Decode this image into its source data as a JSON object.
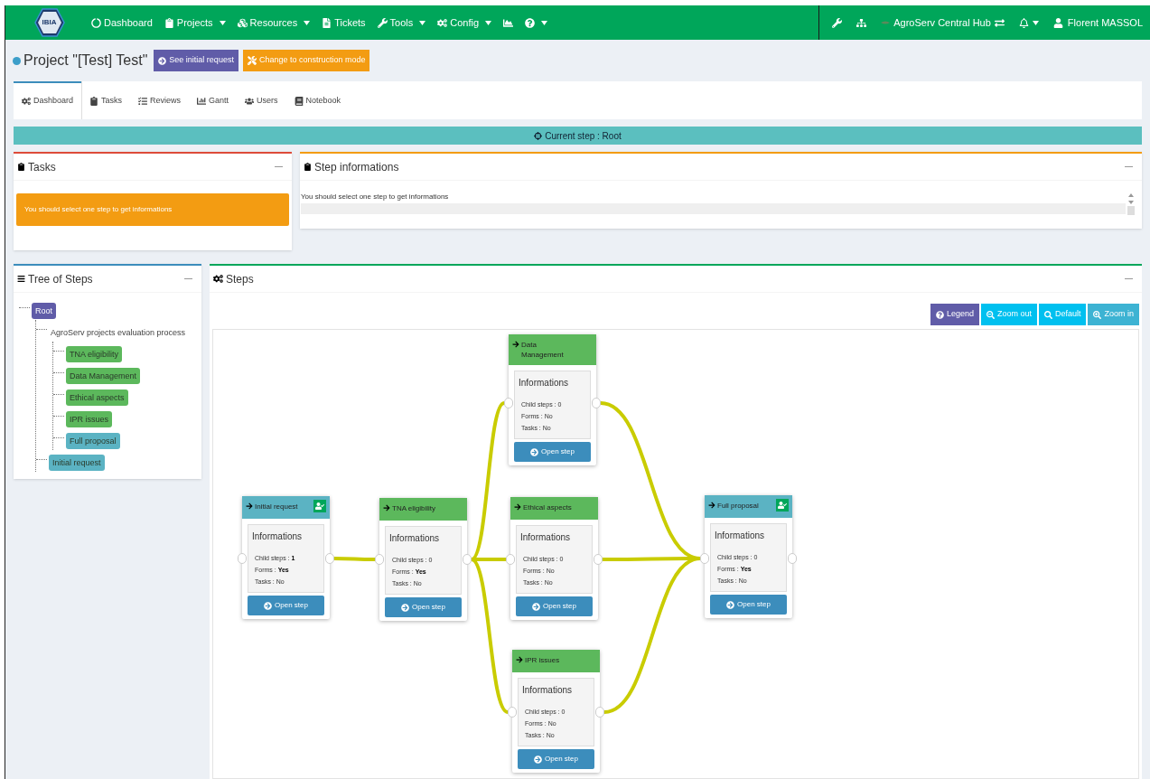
{
  "navbar": {
    "logo": "IBIA",
    "items": [
      {
        "label": "Dashboard",
        "dropdown": false
      },
      {
        "label": "Projects",
        "dropdown": true
      },
      {
        "label": "Resources",
        "dropdown": true
      },
      {
        "label": "Tickets",
        "dropdown": false
      },
      {
        "label": "Tools",
        "dropdown": true
      },
      {
        "label": "Config",
        "dropdown": true
      },
      {
        "dropdown": false
      },
      {
        "dropdown": true
      }
    ],
    "hub": "AgroServ Central Hub",
    "notifications_dropdown": true,
    "user": "Florent MASSOL"
  },
  "project": {
    "title": "Project \"[Test] Test\"",
    "buttons": [
      {
        "label": "See initial request",
        "color": "#605ca8"
      },
      {
        "label": "Change to construction mode",
        "color": "#f39c12"
      }
    ]
  },
  "tabs": [
    {
      "label": "Dashboard",
      "selected": true
    },
    {
      "label": "Tasks",
      "selected": false
    },
    {
      "label": "Reviews",
      "selected": false
    },
    {
      "label": "Gantt",
      "selected": false
    },
    {
      "label": "Users",
      "selected": false
    },
    {
      "label": "Notebook",
      "selected": false
    }
  ],
  "current_step": "Current step : Root",
  "tasks_box": {
    "title": "Tasks",
    "alert": "You should select one step to get informations"
  },
  "step_info": {
    "title": "Step informations",
    "message": "You should select one step to get informations"
  },
  "tree": {
    "title": "Tree of Steps",
    "items": [
      {
        "label": "Root",
        "color": "#605ca8",
        "children": [
          {
            "label": "AgroServ projects evaluation process",
            "children": [
              {
                "label": "TNA eligibility",
                "color": "#5cb85c"
              },
              {
                "label": "Data Management",
                "color": "#5cb85c"
              },
              {
                "label": "Ethical aspects",
                "color": "#5cb85c"
              },
              {
                "label": "IPR issues",
                "color": "#5cb85c"
              },
              {
                "label": "Full proposal",
                "color": "#5bb3c3"
              }
            ]
          },
          {
            "label": "Initial request",
            "color": "#5bb3c3"
          }
        ]
      }
    ]
  },
  "steps": {
    "title": "Steps",
    "toolbar": [
      {
        "label": "Legend",
        "color": "#605ca8"
      },
      {
        "label": "Zoom out",
        "color": "#00c0ef"
      },
      {
        "label": "Default",
        "color": "#00c0ef"
      },
      {
        "label": "Zoom in",
        "color": "#3db3d3"
      }
    ],
    "nodes": [
      {
        "title": "Initial request",
        "color": "#5bb3c3",
        "validated": true,
        "heading": "Informations",
        "lines": [
          {
            "label": "Child steps :",
            "value": "1",
            "bold": true
          },
          {
            "label": "Forms :",
            "value": "Yes",
            "bold": true
          },
          {
            "label": "Tasks :",
            "value": "No",
            "bold": false
          }
        ],
        "button": "Open step"
      },
      {
        "title": "TNA eligibility",
        "color": "#5cb85c",
        "validated": false,
        "heading": "Informations",
        "lines": [
          {
            "label": "Child steps :",
            "value": "0",
            "bold": false
          },
          {
            "label": "Forms :",
            "value": "Yes",
            "bold": true
          },
          {
            "label": "Tasks :",
            "value": "No",
            "bold": false
          }
        ],
        "button": "Open step"
      },
      {
        "title": "Data Management",
        "color": "#5cb85c",
        "validated": false,
        "heading": "Informations",
        "lines": [
          {
            "label": "Child steps :",
            "value": "0",
            "bold": false
          },
          {
            "label": "Forms :",
            "value": "No",
            "bold": false
          },
          {
            "label": "Tasks :",
            "value": "No",
            "bold": false
          }
        ],
        "button": "Open step"
      },
      {
        "title": "Ethical aspects",
        "color": "#5cb85c",
        "validated": false,
        "heading": "Informations",
        "lines": [
          {
            "label": "Child steps :",
            "value": "0",
            "bold": false
          },
          {
            "label": "Forms :",
            "value": "No",
            "bold": false
          },
          {
            "label": "Tasks :",
            "value": "No",
            "bold": false
          }
        ],
        "button": "Open step"
      },
      {
        "title": "IPR issues",
        "color": "#5cb85c",
        "validated": false,
        "heading": "Informations",
        "lines": [
          {
            "label": "Child steps :",
            "value": "0",
            "bold": false
          },
          {
            "label": "Forms :",
            "value": "No",
            "bold": false
          },
          {
            "label": "Tasks :",
            "value": "No",
            "bold": false
          }
        ],
        "button": "Open step"
      },
      {
        "title": "Full proposal",
        "color": "#5bb3c3",
        "validated": true,
        "heading": "Informations",
        "lines": [
          {
            "label": "Child steps :",
            "value": "0",
            "bold": false
          },
          {
            "label": "Forms :",
            "value": "Yes",
            "bold": true
          },
          {
            "label": "Tasks :",
            "value": "No",
            "bold": false
          }
        ],
        "button": "Open step"
      }
    ]
  }
}
